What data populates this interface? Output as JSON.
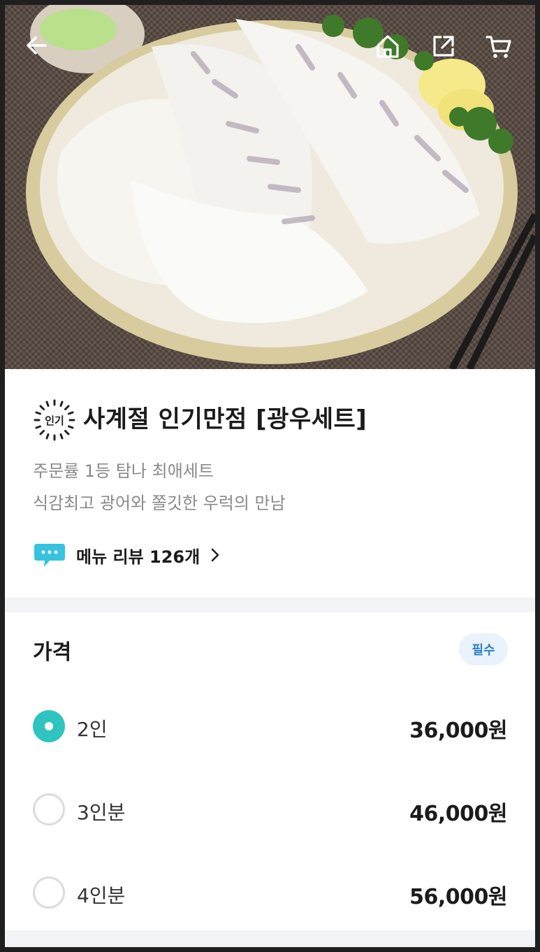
{
  "header": {
    "back_icon": "arrow-left-icon",
    "home_icon": "home-icon",
    "share_icon": "share-icon",
    "cart_icon": "cart-icon"
  },
  "product": {
    "badge": "인기",
    "title": "사계절 인기만점 [광우세트]",
    "description_lines": [
      "주문률 1등 탐나 최애세트",
      "식감최고 광어와 쫄깃한 우럭의 만남"
    ],
    "review_link": "메뉴 리뷰 126개",
    "review_icon": "speech-bubble-icon",
    "review_chevron_icon": "chevron-right-icon"
  },
  "price_section": {
    "title": "가격",
    "required_badge": "필수",
    "options": [
      {
        "label": "2인",
        "price": "36,000원",
        "selected": true
      },
      {
        "label": "3인분",
        "price": "46,000원",
        "selected": false
      },
      {
        "label": "4인분",
        "price": "56,000원",
        "selected": false
      }
    ]
  },
  "colors": {
    "accent_teal": "#2ec4c0",
    "required_blue": "#2d80c7",
    "required_bg": "#eaf3fb"
  }
}
